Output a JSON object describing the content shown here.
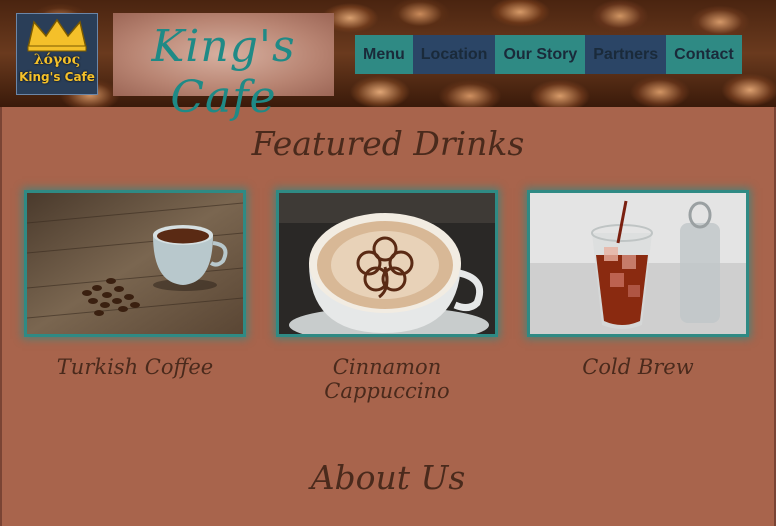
{
  "header": {
    "logo_top": "λόγος",
    "logo_bottom": "King's Cafe",
    "site_title": "King's Cafe"
  },
  "nav": {
    "items": [
      {
        "label": "Menu"
      },
      {
        "label": "Location"
      },
      {
        "label": "Our Story"
      },
      {
        "label": "Partners"
      },
      {
        "label": "Contact"
      }
    ]
  },
  "featured": {
    "heading": "Featured Drinks",
    "drinks": [
      {
        "caption": "Turkish Coffee"
      },
      {
        "caption": "Cinnamon Cappuccino"
      },
      {
        "caption": "Cold Brew"
      }
    ]
  },
  "about": {
    "heading": "About Us"
  },
  "colors": {
    "page_bg": "#a8644c",
    "teal": "#2f8a84",
    "navy": "#2b4566",
    "heading_text": "#4a2a1c",
    "logo_gold": "#f4c02a"
  }
}
